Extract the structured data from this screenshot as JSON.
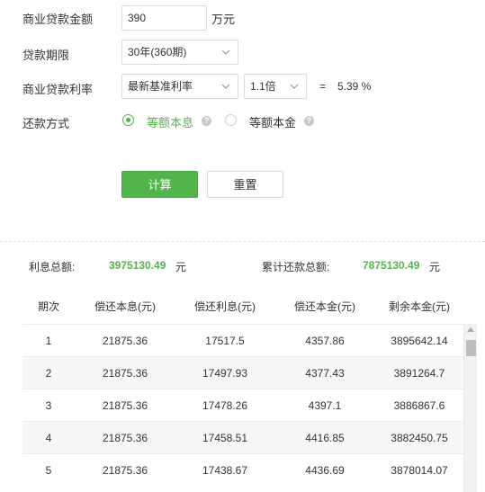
{
  "form": {
    "loan_amount_label": "商业贷款金额",
    "loan_amount_value": "390",
    "loan_amount_unit": "万元",
    "term_label": "贷款期限",
    "term_value": "30年(360期)",
    "rate_label": "商业贷款利率",
    "rate_type_value": "最新基准利率",
    "rate_multiplier_value": "1.1倍",
    "rate_equals": "=",
    "rate_result": "5.39 %",
    "method_label": "还款方式",
    "method_option_1": "等额本息",
    "method_option_2": "等额本金",
    "method_selected": "等额本息",
    "help_glyph": "?"
  },
  "buttons": {
    "calculate": "计算",
    "reset": "重置"
  },
  "summary": {
    "interest_label": "利息总额:",
    "interest_value": "3975130.49",
    "interest_unit": "元",
    "total_label": "累计还款总额:",
    "total_value": "7875130.49",
    "total_unit": "元"
  },
  "table": {
    "headers": [
      "期次",
      "偿还本息(元)",
      "偿还利息(元)",
      "偿还本金(元)",
      "剩余本金(元)"
    ],
    "rows": [
      [
        "1",
        "21875.36",
        "17517.5",
        "4357.86",
        "3895642.14"
      ],
      [
        "2",
        "21875.36",
        "17497.93",
        "4377.43",
        "3891264.7"
      ],
      [
        "3",
        "21875.36",
        "17478.26",
        "4397.1",
        "3886867.6"
      ],
      [
        "4",
        "21875.36",
        "17458.51",
        "4416.85",
        "3882450.75"
      ],
      [
        "5",
        "21875.36",
        "17438.67",
        "4436.69",
        "3878014.07"
      ]
    ]
  },
  "colors": {
    "accent": "#52b54b",
    "row_alt": "#f7f7f7"
  }
}
